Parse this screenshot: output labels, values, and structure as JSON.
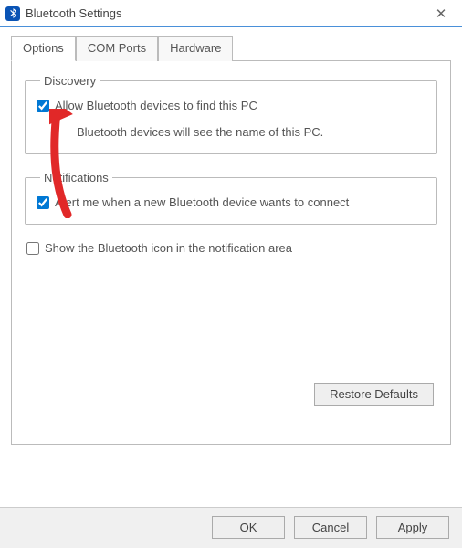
{
  "window": {
    "title": "Bluetooth Settings",
    "close_label": "✕"
  },
  "tabs": [
    {
      "label": "Options",
      "active": true
    },
    {
      "label": "COM Ports",
      "active": false
    },
    {
      "label": "Hardware",
      "active": false
    }
  ],
  "discovery": {
    "group_title": "Discovery",
    "allow_label": "Allow Bluetooth devices to find this PC",
    "allow_checked": true,
    "hint": "Bluetooth devices will see the name of this PC."
  },
  "notifications": {
    "group_title": "Notifications",
    "alert_label": "Alert me when a new Bluetooth device wants to connect",
    "alert_checked": true
  },
  "show_icon": {
    "label": "Show the Bluetooth icon in the notification area",
    "checked": false
  },
  "buttons": {
    "restore": "Restore Defaults",
    "ok": "OK",
    "cancel": "Cancel",
    "apply": "Apply"
  },
  "colors": {
    "arrow": "#e12828",
    "accent": "#0078d4",
    "title_border": "#4a90d9"
  }
}
